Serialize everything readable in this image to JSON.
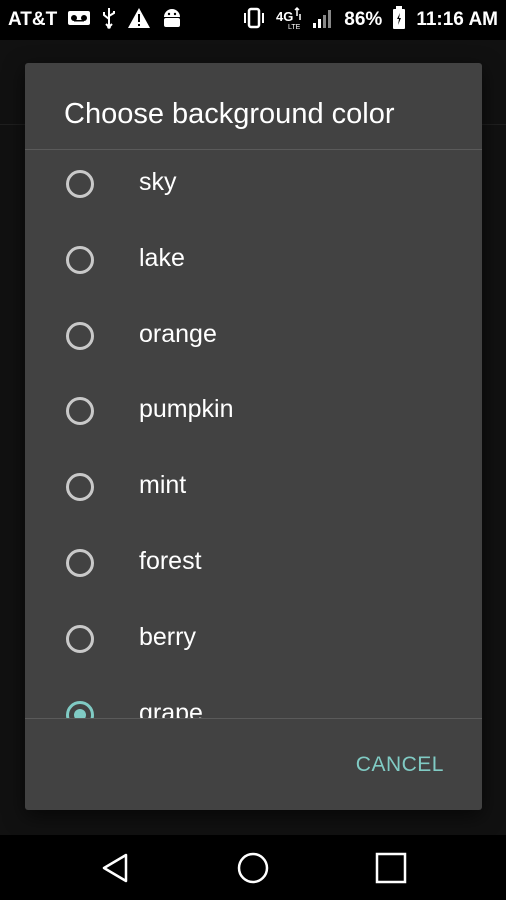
{
  "status_bar": {
    "carrier": "AT&T",
    "battery_percent": "86%",
    "time": "11:16 AM"
  },
  "dialog": {
    "title": "Choose background color",
    "options": [
      {
        "label": "sky",
        "selected": false
      },
      {
        "label": "lake",
        "selected": false
      },
      {
        "label": "orange",
        "selected": false
      },
      {
        "label": "pumpkin",
        "selected": false
      },
      {
        "label": "mint",
        "selected": false
      },
      {
        "label": "forest",
        "selected": false
      },
      {
        "label": "berry",
        "selected": false
      },
      {
        "label": "grape",
        "selected": true
      }
    ],
    "cancel_label": "CANCEL"
  },
  "colors": {
    "accent": "#80cbc4",
    "dialog_bg": "#424242"
  },
  "icons": [
    "voicemail-icon",
    "usb-icon",
    "warning-icon",
    "android-icon",
    "vibrate-icon",
    "data-4g-icon",
    "signal-icon",
    "battery-icon",
    "back-icon",
    "home-icon",
    "recents-icon"
  ]
}
